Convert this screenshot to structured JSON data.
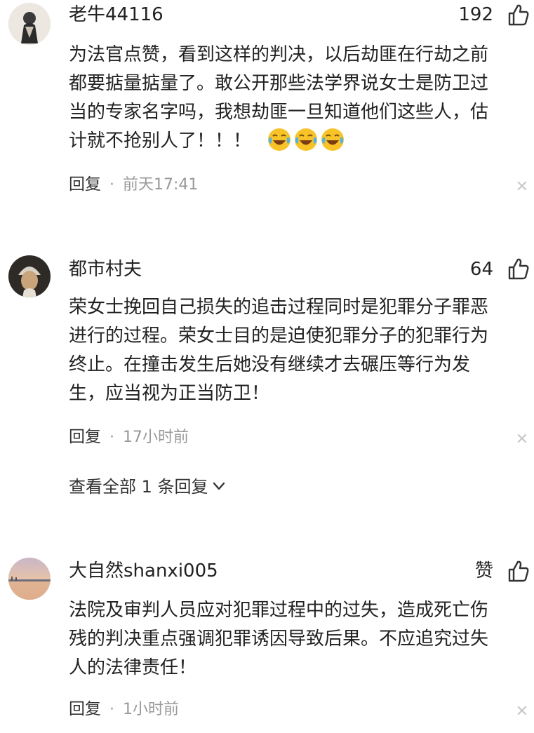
{
  "reply_label": "回复",
  "comments": [
    {
      "username": "老牛44116",
      "likes": "192",
      "text_lines": [
        "为法官点赞，看到这样的判决，以后劫匪在行劫之前",
        "都要掂量掂量了。敢公开那些法学界说女士是防卫过",
        "当的专家名字吗，我想劫匪一旦知道他们这些人，估",
        "计就不抢别人了！！！"
      ],
      "emojis": [
        "crying-laughing-emoji",
        "crying-laughing-emoji",
        "crying-laughing-emoji"
      ],
      "time": "前天17:41"
    },
    {
      "username": "都市村夫",
      "likes": "64",
      "text_lines": [
        "荣女士挽回自己损失的追击过程同时是犯罪分子罪恶",
        "进行的过程。荣女士目的是迫使犯罪分子的犯罪行为",
        "终止。在撞击发生后她没有继续才去碾压等行为发",
        "生，应当视为正当防卫！"
      ],
      "time": "17小时前",
      "view_replies": "查看全部 1 条回复"
    },
    {
      "username": "大自然shanxi005",
      "likes": "赞",
      "text_lines": [
        "法院及审判人员应对犯罪过程中的过失，造成死亡伤",
        "残的判决重点强调犯罪诱因导致后果。不应追究过失",
        "人的法律责任！"
      ],
      "time": "1小时前"
    }
  ]
}
